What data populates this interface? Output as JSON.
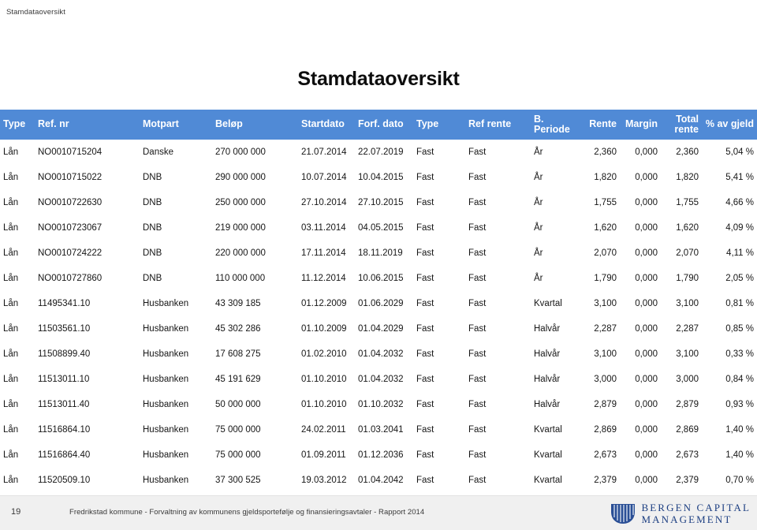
{
  "document": {
    "breadcrumb_title": "Stamdataoversikt"
  },
  "slide": {
    "title": "Stamdataoversikt",
    "header_bg": "#508ad6",
    "header_text_color": "#ffffff"
  },
  "table": {
    "columns": [
      {
        "label": "Type",
        "align": "left"
      },
      {
        "label": "Ref. nr",
        "align": "left"
      },
      {
        "label": "Motpart",
        "align": "left"
      },
      {
        "label": "Beløp",
        "align": "left"
      },
      {
        "label": "Startdato",
        "align": "left"
      },
      {
        "label": "Forf. dato",
        "align": "left"
      },
      {
        "label": "Type",
        "align": "left"
      },
      {
        "label": "Ref rente",
        "align": "left"
      },
      {
        "label": "B. Periode",
        "align": "left"
      },
      {
        "label": "Rente",
        "align": "right"
      },
      {
        "label": "Margin",
        "align": "right"
      },
      {
        "label": "Total rente",
        "align": "right"
      },
      {
        "label": "% av gjeld",
        "align": "right"
      }
    ],
    "rows": [
      {
        "type": "Lån",
        "ref_nr": "NO0010715204",
        "motpart": "Danske",
        "belop": "270 000 000",
        "startdato": "21.07.2014",
        "forf_dato": "22.07.2019",
        "type2": "Fast",
        "ref_rente": "Fast",
        "b_periode": "År",
        "rente": "2,360",
        "margin": "0,000",
        "total_rente": "2,360",
        "andel_gjeld": "5,04 %"
      },
      {
        "type": "Lån",
        "ref_nr": "NO0010715022",
        "motpart": "DNB",
        "belop": "290 000 000",
        "startdato": "10.07.2014",
        "forf_dato": "10.04.2015",
        "type2": "Fast",
        "ref_rente": "Fast",
        "b_periode": "År",
        "rente": "1,820",
        "margin": "0,000",
        "total_rente": "1,820",
        "andel_gjeld": "5,41 %"
      },
      {
        "type": "Lån",
        "ref_nr": "NO0010722630",
        "motpart": "DNB",
        "belop": "250 000 000",
        "startdato": "27.10.2014",
        "forf_dato": "27.10.2015",
        "type2": "Fast",
        "ref_rente": "Fast",
        "b_periode": "År",
        "rente": "1,755",
        "margin": "0,000",
        "total_rente": "1,755",
        "andel_gjeld": "4,66 %"
      },
      {
        "type": "Lån",
        "ref_nr": "NO0010723067",
        "motpart": "DNB",
        "belop": "219 000 000",
        "startdato": "03.11.2014",
        "forf_dato": "04.05.2015",
        "type2": "Fast",
        "ref_rente": "Fast",
        "b_periode": "År",
        "rente": "1,620",
        "margin": "0,000",
        "total_rente": "1,620",
        "andel_gjeld": "4,09 %"
      },
      {
        "type": "Lån",
        "ref_nr": "NO0010724222",
        "motpart": "DNB",
        "belop": "220 000 000",
        "startdato": "17.11.2014",
        "forf_dato": "18.11.2019",
        "type2": "Fast",
        "ref_rente": "Fast",
        "b_periode": "År",
        "rente": "2,070",
        "margin": "0,000",
        "total_rente": "2,070",
        "andel_gjeld": "4,11 %"
      },
      {
        "type": "Lån",
        "ref_nr": "NO0010727860",
        "motpart": "DNB",
        "belop": "110 000 000",
        "startdato": "11.12.2014",
        "forf_dato": "10.06.2015",
        "type2": "Fast",
        "ref_rente": "Fast",
        "b_periode": "År",
        "rente": "1,790",
        "margin": "0,000",
        "total_rente": "1,790",
        "andel_gjeld": "2,05 %"
      },
      {
        "type": "Lån",
        "ref_nr": "11495341.10",
        "motpart": "Husbanken",
        "belop": "43 309 185",
        "startdato": "01.12.2009",
        "forf_dato": "01.06.2029",
        "type2": "Fast",
        "ref_rente": "Fast",
        "b_periode": "Kvartal",
        "rente": "3,100",
        "margin": "0,000",
        "total_rente": "3,100",
        "andel_gjeld": "0,81 %"
      },
      {
        "type": "Lån",
        "ref_nr": "11503561.10",
        "motpart": "Husbanken",
        "belop": "45 302 286",
        "startdato": "01.10.2009",
        "forf_dato": "01.04.2029",
        "type2": "Fast",
        "ref_rente": "Fast",
        "b_periode": "Halvår",
        "rente": "2,287",
        "margin": "0,000",
        "total_rente": "2,287",
        "andel_gjeld": "0,85 %"
      },
      {
        "type": "Lån",
        "ref_nr": "11508899.40",
        "motpart": "Husbanken",
        "belop": "17 608 275",
        "startdato": "01.02.2010",
        "forf_dato": "01.04.2032",
        "type2": "Fast",
        "ref_rente": "Fast",
        "b_periode": "Halvår",
        "rente": "3,100",
        "margin": "0,000",
        "total_rente": "3,100",
        "andel_gjeld": "0,33 %"
      },
      {
        "type": "Lån",
        "ref_nr": "11513011.10",
        "motpart": "Husbanken",
        "belop": "45 191 629",
        "startdato": "01.10.2010",
        "forf_dato": "01.04.2032",
        "type2": "Fast",
        "ref_rente": "Fast",
        "b_periode": "Halvår",
        "rente": "3,000",
        "margin": "0,000",
        "total_rente": "3,000",
        "andel_gjeld": "0,84 %"
      },
      {
        "type": "Lån",
        "ref_nr": "11513011.40",
        "motpart": "Husbanken",
        "belop": "50 000 000",
        "startdato": "01.10.2010",
        "forf_dato": "01.10.2032",
        "type2": "Fast",
        "ref_rente": "Fast",
        "b_periode": "Halvår",
        "rente": "2,879",
        "margin": "0,000",
        "total_rente": "2,879",
        "andel_gjeld": "0,93 %"
      },
      {
        "type": "Lån",
        "ref_nr": "11516864.10",
        "motpart": "Husbanken",
        "belop": "75 000 000",
        "startdato": "24.02.2011",
        "forf_dato": "01.03.2041",
        "type2": "Fast",
        "ref_rente": "Fast",
        "b_periode": "Kvartal",
        "rente": "2,869",
        "margin": "0,000",
        "total_rente": "2,869",
        "andel_gjeld": "1,40 %"
      },
      {
        "type": "Lån",
        "ref_nr": "11516864.40",
        "motpart": "Husbanken",
        "belop": "75 000 000",
        "startdato": "01.09.2011",
        "forf_dato": "01.12.2036",
        "type2": "Fast",
        "ref_rente": "Fast",
        "b_periode": "Kvartal",
        "rente": "2,673",
        "margin": "0,000",
        "total_rente": "2,673",
        "andel_gjeld": "1,40 %"
      },
      {
        "type": "Lån",
        "ref_nr": "11520509.10",
        "motpart": "Husbanken",
        "belop": "37 300 525",
        "startdato": "19.03.2012",
        "forf_dato": "01.04.2042",
        "type2": "Fast",
        "ref_rente": "Fast",
        "b_periode": "Kvartal",
        "rente": "2,379",
        "margin": "0,000",
        "total_rente": "2,379",
        "andel_gjeld": "0,70 %"
      }
    ]
  },
  "footer": {
    "page_number": "19",
    "text": "Fredrikstad kommune - Forvaltning av kommunens gjeldsportefølje og finansieringsavtaler  - Rapport 2014",
    "logo": {
      "line1": "BERGEN CAPITAL",
      "line2": "MANAGEMENT",
      "color": "#1d3f82"
    }
  }
}
